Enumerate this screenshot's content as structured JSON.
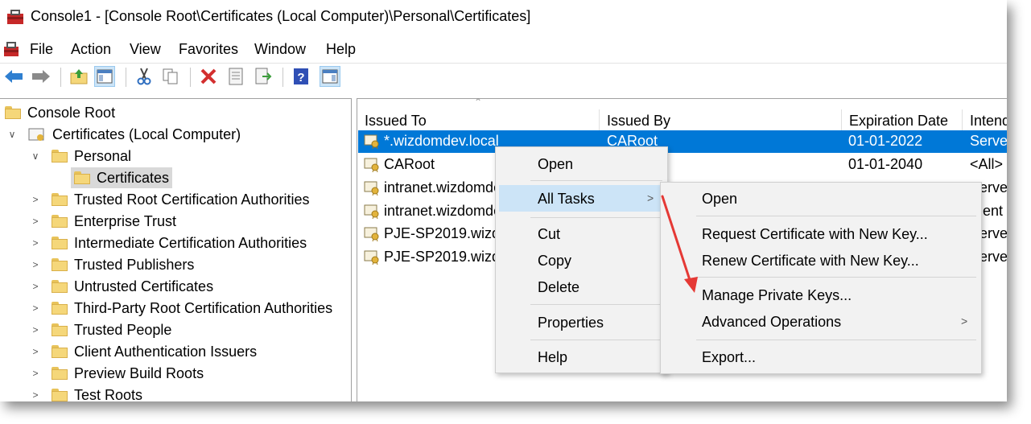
{
  "title": "Console1 - [Console Root\\Certificates (Local Computer)\\Personal\\Certificates]",
  "menu": [
    "File",
    "Action",
    "View",
    "Favorites",
    "Window",
    "Help"
  ],
  "toolbar_icons": [
    "back-arrow-icon",
    "forward-arrow-icon",
    "up-folder-icon",
    "show-hide-tree-icon",
    "cut-icon",
    "copy-icon",
    "delete-icon",
    "properties-icon",
    "export-list-icon",
    "help-icon",
    "show-hide-action-pane-icon"
  ],
  "tree": {
    "root": "Console Root",
    "certificates": "Certificates (Local Computer)",
    "personal": "Personal",
    "personal_certificates": "Certificates",
    "stores": [
      "Trusted Root Certification Authorities",
      "Enterprise Trust",
      "Intermediate Certification Authorities",
      "Trusted Publishers",
      "Untrusted Certificates",
      "Third-Party Root Certification Authorities",
      "Trusted People",
      "Client Authentication Issuers",
      "Preview Build Roots",
      "Test Roots"
    ]
  },
  "list": {
    "columns": [
      "Issued To",
      "Issued By",
      "Expiration Date",
      "Intend"
    ],
    "rows": [
      {
        "issued_to": "*.wizdomdev.local",
        "issued_by": "CARoot",
        "expires": "01-01-2022",
        "intended": "Server"
      },
      {
        "issued_to": "CARoot",
        "issued_by": "",
        "expires": "01-01-2040",
        "intended": "<All>"
      },
      {
        "issued_to": "intranet.wizdomde",
        "issued_by": "",
        "expires": "",
        "intended": "erver"
      },
      {
        "issued_to": "intranet.wizdomde",
        "issued_by": "",
        "expires": "",
        "intended": "ient"
      },
      {
        "issued_to": "PJE-SP2019.wizdor",
        "issued_by": "",
        "expires": "",
        "intended": "erver"
      },
      {
        "issued_to": "PJE-SP2019.wizdor",
        "issued_by": "",
        "expires": "",
        "intended": "erver"
      }
    ]
  },
  "context_menu": {
    "open": "Open",
    "all_tasks": "All Tasks",
    "cut": "Cut",
    "copy": "Copy",
    "delete": "Delete",
    "properties": "Properties",
    "help": "Help"
  },
  "submenu": {
    "open": "Open",
    "request_new_key": "Request Certificate with New Key...",
    "renew_new_key": "Renew Certificate with New Key...",
    "manage_private_keys": "Manage Private Keys...",
    "advanced_operations": "Advanced Operations",
    "export": "Export..."
  },
  "colors": {
    "selection": "#0078d7",
    "menu_bg": "#f2f2f2",
    "menu_highlight": "#cce4f7",
    "annotation_arrow": "#e53935"
  }
}
